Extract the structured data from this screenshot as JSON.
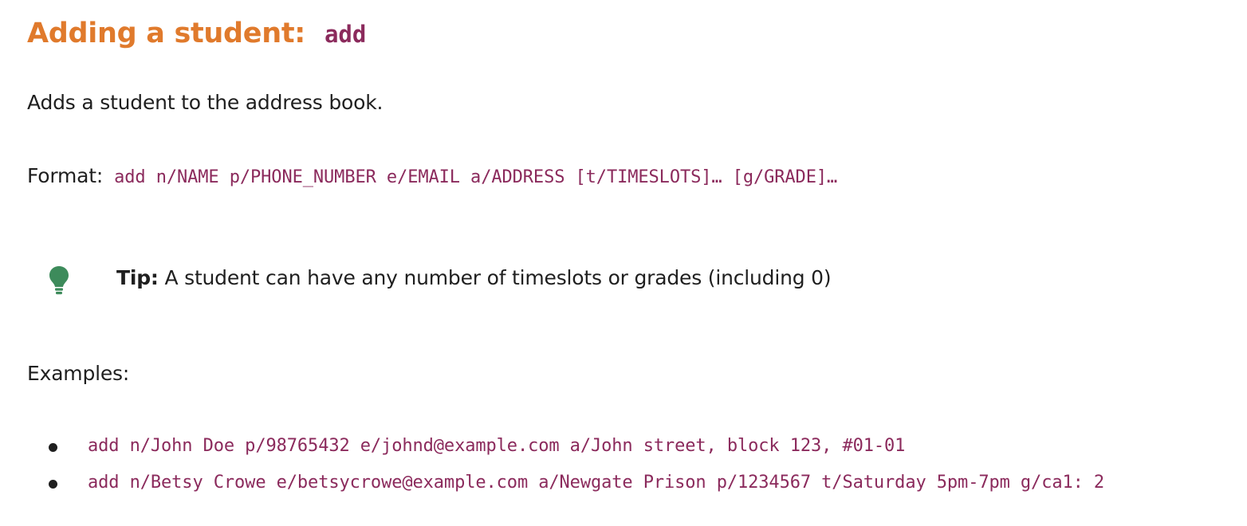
{
  "heading": {
    "title": "Adding a student:",
    "command": "add"
  },
  "description": "Adds a student to the address book.",
  "format": {
    "label": "Format:",
    "syntax": "add n/NAME p/PHONE_NUMBER e/EMAIL a/ADDRESS [t/TIMESLOTS]… [g/GRADE]…"
  },
  "tip": {
    "icon": "lightbulb-icon",
    "icon_color": "#3d8b5b",
    "label": "Tip:",
    "text": " A student can have any number of timeslots or grades (including 0)"
  },
  "examples": {
    "label": "Examples:",
    "items": [
      "add n/John Doe p/98765432 e/johnd@example.com a/John street, block 123, #01-01",
      "add n/Betsy Crowe e/betsycrowe@example.com a/Newgate Prison p/1234567 t/Saturday 5pm-7pm g/ca1: 2"
    ]
  },
  "colors": {
    "heading": "#e07a2c",
    "code": "#8b2a5c",
    "text": "#1f1f1f"
  }
}
